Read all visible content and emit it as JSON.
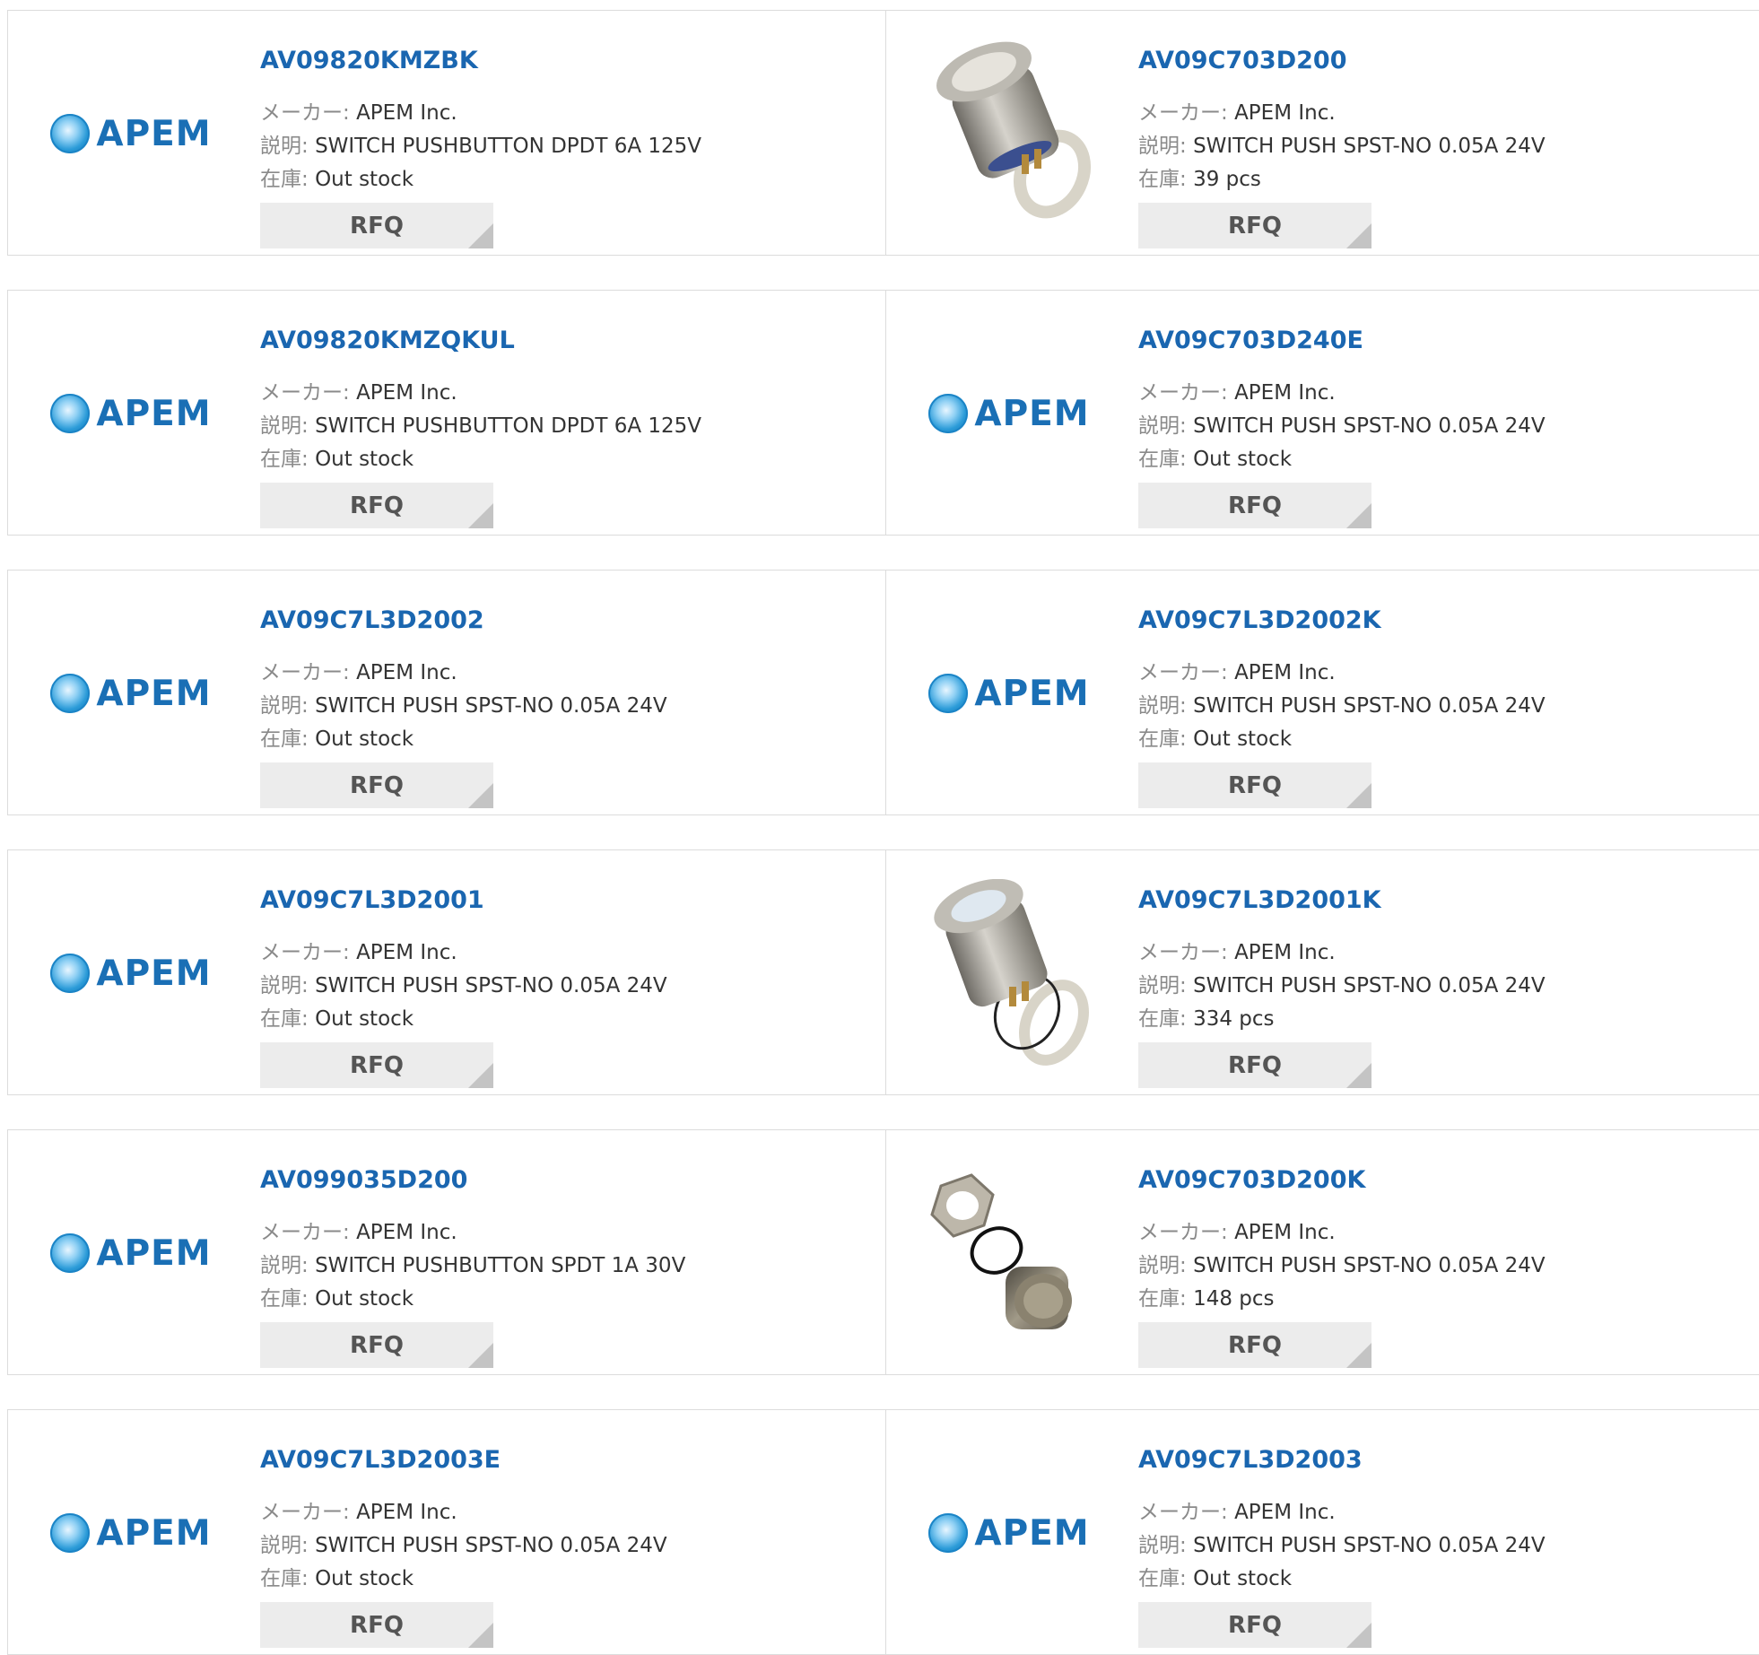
{
  "labels": {
    "maker": "メーカー:",
    "desc": "説明:",
    "stock": "在庫:",
    "rfq": "RFQ"
  },
  "logo_text": "APEM",
  "colors": {
    "part_number": "#1a66b0",
    "logo": "#1a6fb5",
    "rfq_bg": "#ececec"
  },
  "items": [
    {
      "pn": "AV09820KMZBK",
      "maker": "APEM Inc.",
      "desc": "SWITCH PUSHBUTTON DPDT 6A 125V",
      "stock": "Out stock",
      "image": "apem-logo"
    },
    {
      "pn": "AV09C703D200",
      "maker": "APEM Inc.",
      "desc": "SWITCH PUSH SPST-NO 0.05A 24V",
      "stock": "39 pcs",
      "image": "switch-photo-a"
    },
    {
      "pn": "AV09820KMZQKUL",
      "maker": "APEM Inc.",
      "desc": "SWITCH PUSHBUTTON DPDT 6A 125V",
      "stock": "Out stock",
      "image": "apem-logo"
    },
    {
      "pn": "AV09C703D240E",
      "maker": "APEM Inc.",
      "desc": "SWITCH PUSH SPST-NO 0.05A 24V",
      "stock": "Out stock",
      "image": "apem-logo"
    },
    {
      "pn": "AV09C7L3D2002",
      "maker": "APEM Inc.",
      "desc": "SWITCH PUSH SPST-NO 0.05A 24V",
      "stock": "Out stock",
      "image": "apem-logo"
    },
    {
      "pn": "AV09C7L3D2002K",
      "maker": "APEM Inc.",
      "desc": "SWITCH PUSH SPST-NO 0.05A 24V",
      "stock": "Out stock",
      "image": "apem-logo"
    },
    {
      "pn": "AV09C7L3D2001",
      "maker": "APEM Inc.",
      "desc": "SWITCH PUSH SPST-NO 0.05A 24V",
      "stock": "Out stock",
      "image": "apem-logo"
    },
    {
      "pn": "AV09C7L3D2001K",
      "maker": "APEM Inc.",
      "desc": "SWITCH PUSH SPST-NO 0.05A 24V",
      "stock": "334 pcs",
      "image": "switch-photo-b"
    },
    {
      "pn": "AV099035D200",
      "maker": "APEM Inc.",
      "desc": "SWITCH PUSHBUTTON SPDT 1A 30V",
      "stock": "Out stock",
      "image": "apem-logo"
    },
    {
      "pn": "AV09C703D200K",
      "maker": "APEM Inc.",
      "desc": "SWITCH PUSH SPST-NO 0.05A 24V",
      "stock": "148 pcs",
      "image": "switch-photo-c"
    },
    {
      "pn": "AV09C7L3D2003E",
      "maker": "APEM Inc.",
      "desc": "SWITCH PUSH SPST-NO 0.05A 24V",
      "stock": "Out stock",
      "image": "apem-logo"
    },
    {
      "pn": "AV09C7L3D2003",
      "maker": "APEM Inc.",
      "desc": "SWITCH PUSH SPST-NO 0.05A 24V",
      "stock": "Out stock",
      "image": "apem-logo"
    }
  ]
}
